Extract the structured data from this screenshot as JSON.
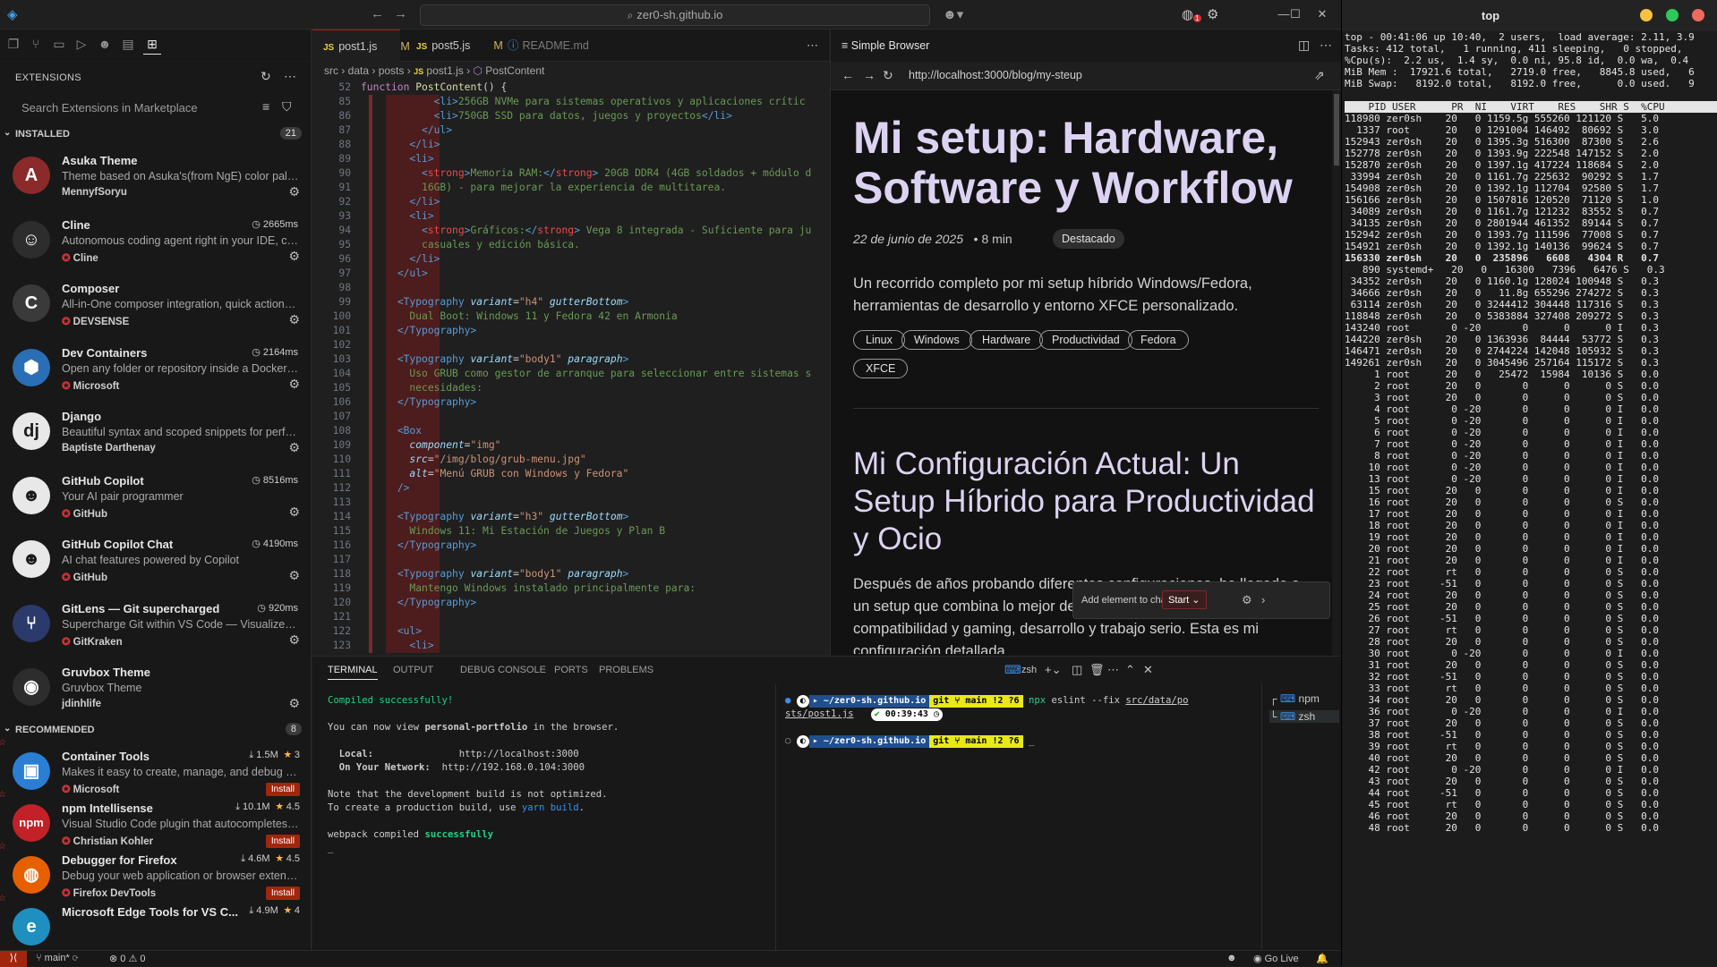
{
  "vscode": {
    "title": "zer0-sh.github.io",
    "titlebar_badge": "1",
    "sidebar": {
      "header": "EXTENSIONS",
      "search_placeholder": "Search Extensions in Marketplace",
      "installed_label": "INSTALLED",
      "installed_count": "21",
      "recommended_label": "RECOMMENDED",
      "recommended_count": "8",
      "installed": [
        {
          "name": "Asuka Theme",
          "desc": "Theme based on Asuka's(from NgE) color palett...",
          "pub": "MennyfSoryu",
          "ms": "",
          "verified": false,
          "logo": "A",
          "color": "#8b2a2a"
        },
        {
          "name": "Cline",
          "desc": "Autonomous coding agent right in your IDE, cap...",
          "pub": "Cline",
          "ms": "2665ms",
          "verified": true,
          "logo": "☺",
          "color": "#2d2d2d"
        },
        {
          "name": "Composer",
          "desc": "All-in-One composer integration, quick actions, ...",
          "pub": "DEVSENSE",
          "ms": "",
          "verified": true,
          "logo": "C",
          "color": "#3a3a3a"
        },
        {
          "name": "Dev Containers",
          "desc": "Open any folder or repository inside a Docker co...",
          "pub": "Microsoft",
          "ms": "2164ms",
          "verified": true,
          "logo": "⬢",
          "color": "#2a6fb5"
        },
        {
          "name": "Django",
          "desc": "Beautiful syntax and scoped snippets for perfec...",
          "pub": "Baptiste Darthenay",
          "ms": "",
          "verified": false,
          "logo": "dj",
          "color": "#e8e8e8"
        },
        {
          "name": "GitHub Copilot",
          "desc": "Your AI pair programmer",
          "pub": "GitHub",
          "ms": "8516ms",
          "verified": true,
          "logo": "☻",
          "color": "#e8e8e8"
        },
        {
          "name": "GitHub Copilot Chat",
          "desc": "AI chat features powered by Copilot",
          "pub": "GitHub",
          "ms": "4190ms",
          "verified": true,
          "logo": "☻",
          "color": "#e8e8e8"
        },
        {
          "name": "GitLens — Git supercharged",
          "desc": "Supercharge Git within VS Code — Visualize co...",
          "pub": "GitKraken",
          "ms": "920ms",
          "verified": true,
          "logo": "⑂",
          "color": "#2b3a6b"
        },
        {
          "name": "Gruvbox Theme",
          "desc": "Gruvbox Theme",
          "pub": "jdinhlife",
          "ms": "",
          "verified": false,
          "logo": "◉",
          "color": "#2d2d2d"
        }
      ],
      "recommended": [
        {
          "name": "Container Tools",
          "desc": "Makes it easy to create, manage, and debug co...",
          "pub": "Microsoft",
          "downloads": "1.5M",
          "rating": "3",
          "logo": "▣",
          "color": "#2a7fd4"
        },
        {
          "name": "npm Intellisense",
          "desc": "Visual Studio Code plugin that autocompletes n...",
          "pub": "Christian Kohler",
          "downloads": "10.1M",
          "rating": "4.5",
          "logo": "npm",
          "color": "#c12127"
        },
        {
          "name": "Debugger for Firefox",
          "desc": "Debug your web application or browser extensi...",
          "pub": "Firefox DevTools",
          "downloads": "4.6M",
          "rating": "4.5",
          "logo": "◍",
          "color": "#e66000"
        },
        {
          "name": "Microsoft Edge Tools for VS C...",
          "desc": "",
          "pub": "",
          "downloads": "4.9M",
          "rating": "4",
          "logo": "e",
          "color": "#1f8fbf"
        }
      ],
      "install_label": "Install"
    },
    "editor": {
      "tabs": [
        {
          "label": "post1.js",
          "modified": "M"
        },
        {
          "label": "post5.js",
          "modified": "M"
        },
        {
          "label": "README.md",
          "modified": ""
        }
      ],
      "breadcrumb": [
        "src",
        "data",
        "posts",
        "post1.js",
        "PostContent"
      ],
      "lines": [
        {
          "n": "52",
          "html": "<span class='kw'>function</span> <span class='fn'>PostContent</span>() {"
        },
        {
          "n": "85",
          "html": "            <span class='tg'>&lt;li&gt;</span><span class='tx'>256GB NVMe para sistemas operativos y aplicaciones crític</span>"
        },
        {
          "n": "86",
          "html": "            <span class='tg'>&lt;li&gt;</span><span class='tx'>750GB SSD para datos, juegos y proyectos</span><span class='tg'>&lt;/li&gt;</span>"
        },
        {
          "n": "87",
          "html": "          <span class='tg'>&lt;/ul&gt;</span>"
        },
        {
          "n": "88",
          "html": "        <span class='tg'>&lt;/li&gt;</span>"
        },
        {
          "n": "89",
          "html": "        <span class='tg'>&lt;li&gt;</span>"
        },
        {
          "n": "90",
          "html": "          <span class='tg'>&lt;</span><span class='tag2'>strong</span><span class='tg'>&gt;</span><span class='tx'>Memoria RAM:</span><span class='tg'>&lt;/</span><span class='tag2'>strong</span><span class='tg'>&gt;</span><span class='tx'> 20GB DDR4 (4GB soldados + módulo d</span>"
        },
        {
          "n": "91",
          "html": "          <span class='tx'>16GB) - para mejorar la experiencia de multitarea.</span>"
        },
        {
          "n": "92",
          "html": "        <span class='tg'>&lt;/li&gt;</span>"
        },
        {
          "n": "93",
          "html": "        <span class='tg'>&lt;li&gt;</span>"
        },
        {
          "n": "94",
          "html": "          <span class='tg'>&lt;</span><span class='tag2'>strong</span><span class='tg'>&gt;</span><span class='tx'>Gráficos:</span><span class='tg'>&lt;/</span><span class='tag2'>strong</span><span class='tg'>&gt;</span><span class='tx'> Vega 8 integrada - Suficiente para ju</span>"
        },
        {
          "n": "95",
          "html": "          <span class='tx'>casuales y edición básica.</span>"
        },
        {
          "n": "96",
          "html": "        <span class='tg'>&lt;/li&gt;</span>"
        },
        {
          "n": "97",
          "html": "      <span class='tg'>&lt;/ul&gt;</span>"
        },
        {
          "n": "98",
          "html": ""
        },
        {
          "n": "99",
          "html": "      <span class='tg'>&lt;Typography</span> <span class='at'>variant</span>=<span class='st'>\"h4\"</span> <span class='at'>gutterBottom</span><span class='tg'>&gt;</span>"
        },
        {
          "n": "100",
          "html": "        <span class='tx'>Dual Boot: Windows 11 y Fedora 42 en Armonía</span>"
        },
        {
          "n": "101",
          "html": "      <span class='tg'>&lt;/Typography&gt;</span>"
        },
        {
          "n": "102",
          "html": ""
        },
        {
          "n": "103",
          "html": "      <span class='tg'>&lt;Typography</span> <span class='at'>variant</span>=<span class='st'>\"body1\"</span> <span class='at'>paragraph</span><span class='tg'>&gt;</span>"
        },
        {
          "n": "104",
          "html": "        <span class='tx'>Uso GRUB como gestor de arranque para seleccionar entre sistemas s</span>"
        },
        {
          "n": "105",
          "html": "        <span class='tx'>necesidades:</span>"
        },
        {
          "n": "106",
          "html": "      <span class='tg'>&lt;/Typography&gt;</span>"
        },
        {
          "n": "107",
          "html": ""
        },
        {
          "n": "108",
          "html": "      <span class='tg'>&lt;Box</span>"
        },
        {
          "n": "109",
          "html": "        <span class='at'>component</span>=<span class='st'>\"img\"</span>"
        },
        {
          "n": "110",
          "html": "        <span class='at'>src</span>=<span class='st'>\"/img/blog/grub-menu.jpg\"</span>"
        },
        {
          "n": "111",
          "html": "        <span class='at'>alt</span>=<span class='st'>\"Menú GRUB con Windows y Fedora\"</span>"
        },
        {
          "n": "112",
          "html": "      <span class='tg'>/&gt;</span>"
        },
        {
          "n": "113",
          "html": ""
        },
        {
          "n": "114",
          "html": "      <span class='tg'>&lt;Typography</span> <span class='at'>variant</span>=<span class='st'>\"h3\"</span> <span class='at'>gutterBottom</span><span class='tg'>&gt;</span>"
        },
        {
          "n": "115",
          "html": "        <span class='tx'>Windows 11: Mi Estación de Juegos y Plan B</span>"
        },
        {
          "n": "116",
          "html": "      <span class='tg'>&lt;/Typography&gt;</span>"
        },
        {
          "n": "117",
          "html": ""
        },
        {
          "n": "118",
          "html": "      <span class='tg'>&lt;Typography</span> <span class='at'>variant</span>=<span class='st'>\"body1\"</span> <span class='at'>paragraph</span><span class='tg'>&gt;</span>"
        },
        {
          "n": "119",
          "html": "        <span class='tx'>Mantengo Windows instalado principalmente para:</span>"
        },
        {
          "n": "120",
          "html": "      <span class='tg'>&lt;/Typography&gt;</span>"
        },
        {
          "n": "121",
          "html": ""
        },
        {
          "n": "122",
          "html": "      <span class='tg'>&lt;ul&gt;</span>"
        },
        {
          "n": "123",
          "html": "        <span class='tg'>&lt;li&gt;</span>"
        }
      ]
    },
    "browser": {
      "tab_title": "Simple Browser",
      "url": "http://localhost:3000/blog/my-steup",
      "h1": "Mi setup: Hardware, Software y Workflow",
      "date": "22 de junio de 2025",
      "read_time": "• 8 min",
      "badge": "Destacado",
      "lead": "Un recorrido completo por mi setup híbrido Windows/Fedora, herramientas de desarrollo y entorno XFCE personalizado.",
      "tags": [
        "Linux",
        "Windows",
        "Hardware",
        "Productividad",
        "Fedora",
        "XFCE"
      ],
      "h2": "Mi Configuración Actual: Un Setup Híbrido para Productividad y Ocio",
      "p2": "Después de años probando diferentes configuraciones, he llegado a un setup que combina lo mejor de Linux y Windows para compatibilidad y gaming, desarrollo y trabajo serio. Esta es mi configuración detallada",
      "chat_label": "Add element to chat",
      "chat_start": "Start"
    },
    "panel": {
      "tabs": [
        "TERMINAL",
        "OUTPUT",
        "DEBUG CONSOLE",
        "PORTS",
        "PROBLEMS"
      ],
      "shell": "zsh",
      "term1": {
        "l1": "Compiled successfully!",
        "l2a": "You can now view ",
        "l2b": "personal-portfolio",
        "l2c": " in the browser.",
        "local_label": "  Local:",
        "local_url": "http://localhost:3000",
        "net_label": "  On Your Network:",
        "net_url": "http://192.168.0.104:3000",
        "n1": "Note that the development build is not optimized.",
        "n2a": "To create a production build, use ",
        "n2b": "yarn build",
        "n2c": ".",
        "w1a": "webpack compiled ",
        "w1b": "successfully",
        "cursor": "_"
      },
      "term2": {
        "path": "~/zer0-sh.github.io",
        "git": "git",
        "branch": "main !2 ?6",
        "cmd_pre": "npx",
        "cmd_rest": " eslint --fix ",
        "cmd_arg": "src/data/po",
        "cmd_arg2": "sts/post1.js",
        "check": "✔",
        "time": "00:39:43",
        "cursor": "_"
      },
      "terminals": [
        "npm",
        "zsh"
      ]
    },
    "status": {
      "branch": "main*",
      "errors": "⊗ 0 ⚠ 0",
      "golive": "Go Live"
    }
  },
  "top": {
    "title": "top",
    "header_lines": [
      "top - 00:41:06 up 10:40,  2 users,  load average: 2.11, 3.9",
      "Tasks: 412 total,   1 running, 411 sleeping,   0 stopped,",
      "%Cpu(s):  2.2 us,  1.4 sy,  0.0 ni, 95.8 id,  0.0 wa,  0.4",
      "MiB Mem :  17921.6 total,   2719.0 free,   8845.8 used,   6",
      "MiB Swap:   8192.0 total,   8192.0 free,      0.0 used.   9"
    ],
    "columns": "    PID USER      PR  NI    VIRT    RES    SHR S  %CPU",
    "rows": [
      "118980 zer0sh    20   0 1159.5g 555260 121120 S   5.0",
      "  1337 root      20   0 1291004 146492  80692 S   3.0",
      "152943 zer0sh    20   0 1395.3g 516300  87300 S   2.6",
      "152778 zer0sh    20   0 1393.9g 222548 147152 S   2.0",
      "152870 zer0sh    20   0 1397.1g 417224 118684 S   2.0",
      " 33994 zer0sh    20   0 1161.7g 225632  90292 S   1.7",
      "154908 zer0sh    20   0 1392.1g 112704  92580 S   1.7",
      "156166 zer0sh    20   0 1507816 120520  71120 S   1.0",
      " 34089 zer0sh    20   0 1161.7g 121232  83552 S   0.7",
      " 34135 zer0sh    20   0 2801944 461352  89144 S   0.7",
      "152942 zer0sh    20   0 1393.7g 111596  77008 S   0.7",
      "154921 zer0sh    20   0 1392.1g 140136  99624 S   0.7",
      "156330 zer0sh    20   0  235896   6608   4304 R   0.7",
      "   890 systemd+   20   0   16300   7396   6476 S   0.3",
      " 34352 zer0sh    20   0 1160.1g 128024 100948 S   0.3",
      " 34666 zer0sh    20   0   11.8g 655296 274272 S   0.3",
      " 63114 zer0sh    20   0 3244412 304448 117316 S   0.3",
      "118848 zer0sh    20   0 5383884 327408 209272 S   0.3",
      "143240 root       0 -20       0      0      0 I   0.3",
      "144220 zer0sh    20   0 1363936  84444  53772 S   0.3",
      "146471 zer0sh    20   0 2744224 142048 105932 S   0.3",
      "149261 zer0sh    20   0 3045496 257164 115172 S   0.3",
      "     1 root      20   0   25472  15984  10136 S   0.0",
      "     2 root      20   0       0      0      0 S   0.0",
      "     3 root      20   0       0      0      0 S   0.0",
      "     4 root       0 -20       0      0      0 I   0.0",
      "     5 root       0 -20       0      0      0 I   0.0",
      "     6 root       0 -20       0      0      0 I   0.0",
      "     7 root       0 -20       0      0      0 I   0.0",
      "     8 root       0 -20       0      0      0 I   0.0",
      "    10 root       0 -20       0      0      0 I   0.0",
      "    13 root       0 -20       0      0      0 I   0.0",
      "    15 root      20   0       0      0      0 I   0.0",
      "    16 root      20   0       0      0      0 S   0.0",
      "    17 root      20   0       0      0      0 I   0.0",
      "    18 root      20   0       0      0      0 I   0.0",
      "    19 root      20   0       0      0      0 I   0.0",
      "    20 root      20   0       0      0      0 I   0.0",
      "    21 root      20   0       0      0      0 I   0.0",
      "    22 root      rt   0       0      0      0 S   0.0",
      "    23 root     -51   0       0      0      0 S   0.0",
      "    24 root      20   0       0      0      0 S   0.0",
      "    25 root      20   0       0      0      0 S   0.0",
      "    26 root     -51   0       0      0      0 S   0.0",
      "    27 root      rt   0       0      0      0 S   0.0",
      "    28 root      20   0       0      0      0 S   0.0",
      "    30 root       0 -20       0      0      0 I   0.0",
      "    31 root      20   0       0      0      0 S   0.0",
      "    32 root     -51   0       0      0      0 S   0.0",
      "    33 root      rt   0       0      0      0 S   0.0",
      "    34 root      20   0       0      0      0 S   0.0",
      "    36 root       0 -20       0      0      0 I   0.0",
      "    37 root      20   0       0      0      0 S   0.0",
      "    38 root     -51   0       0      0      0 S   0.0",
      "    39 root      rt   0       0      0      0 S   0.0",
      "    40 root      20   0       0      0      0 S   0.0",
      "    42 root       0 -20       0      0      0 I   0.0",
      "    43 root      20   0       0      0      0 S   0.0",
      "    44 root     -51   0       0      0      0 S   0.0",
      "    45 root      rt   0       0      0      0 S   0.0",
      "    46 root      20   0       0      0      0 S   0.0",
      "    48 root      20   0       0      0      0 S   0.0"
    ]
  }
}
